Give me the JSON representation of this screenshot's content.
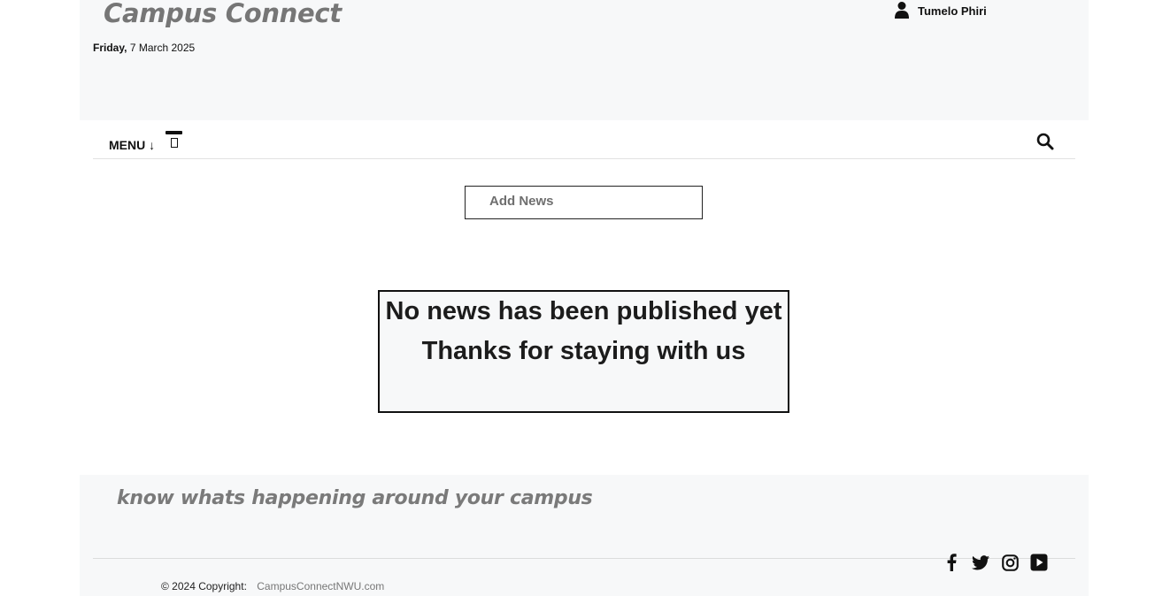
{
  "header": {
    "site_title": "Campus Connect",
    "date_day": "Friday,",
    "date_rest": "7 March 2025",
    "user_name": "Tumelo Phiri"
  },
  "nav": {
    "menu_label": "MENU ↓",
    "icons": [
      "menu-toggle-icon",
      "search-icon"
    ]
  },
  "main": {
    "add_news_label": "Add News",
    "empty_line1": "No news has been published yet",
    "empty_line2": "Thanks for staying with us"
  },
  "footer": {
    "tagline": "know whats happening around your campus",
    "copyright_label": "© 2024 Copyright:",
    "site_link": "CampusConnectNWU.com",
    "social_icons": [
      "facebook-icon",
      "twitter-icon",
      "instagram-icon",
      "youtube-icon"
    ]
  }
}
